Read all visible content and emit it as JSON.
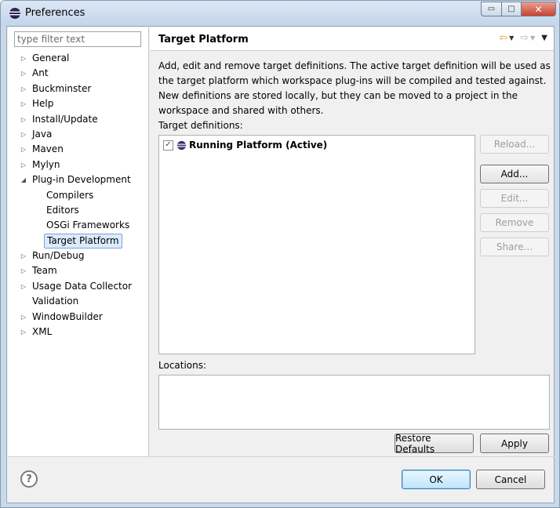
{
  "window": {
    "title": "Preferences",
    "minimize_glyph": "▭",
    "maximize_glyph": "□",
    "close_glyph": "✕"
  },
  "filter": {
    "placeholder": "type filter text",
    "value": ""
  },
  "tree": {
    "items": [
      {
        "label": "General",
        "expandable": true,
        "expanded": false,
        "level": 0
      },
      {
        "label": "Ant",
        "expandable": true,
        "expanded": false,
        "level": 0
      },
      {
        "label": "Buckminster",
        "expandable": true,
        "expanded": false,
        "level": 0
      },
      {
        "label": "Help",
        "expandable": true,
        "expanded": false,
        "level": 0
      },
      {
        "label": "Install/Update",
        "expandable": true,
        "expanded": false,
        "level": 0
      },
      {
        "label": "Java",
        "expandable": true,
        "expanded": false,
        "level": 0
      },
      {
        "label": "Maven",
        "expandable": true,
        "expanded": false,
        "level": 0
      },
      {
        "label": "Mylyn",
        "expandable": true,
        "expanded": false,
        "level": 0
      },
      {
        "label": "Plug-in Development",
        "expandable": true,
        "expanded": true,
        "level": 0
      },
      {
        "label": "Compilers",
        "expandable": false,
        "level": 1
      },
      {
        "label": "Editors",
        "expandable": false,
        "level": 1
      },
      {
        "label": "OSGi Frameworks",
        "expandable": false,
        "level": 1
      },
      {
        "label": "Target Platform",
        "expandable": false,
        "level": 1,
        "selected": true
      },
      {
        "label": "Run/Debug",
        "expandable": true,
        "expanded": false,
        "level": 0
      },
      {
        "label": "Team",
        "expandable": true,
        "expanded": false,
        "level": 0
      },
      {
        "label": "Usage Data Collector",
        "expandable": true,
        "expanded": false,
        "level": 0
      },
      {
        "label": "Validation",
        "expandable": false,
        "level": 0
      },
      {
        "label": "WindowBuilder",
        "expandable": true,
        "expanded": false,
        "level": 0
      },
      {
        "label": "XML",
        "expandable": true,
        "expanded": false,
        "level": 0
      }
    ],
    "collapsed_glyph": "▷",
    "expanded_glyph": "◢"
  },
  "page": {
    "title": "Target Platform",
    "nav": {
      "back_glyph": "⇦",
      "forward_glyph": "⇨",
      "dropdown_glyph": "▼",
      "menu_glyph": "▼"
    },
    "description": "Add, edit and remove target definitions.  The active target definition will be used as the target platform which workspace plug-ins will be compiled and tested against.  New definitions are stored locally, but they can be moved to a project in the workspace and shared with others.",
    "definitions_label": "Target definitions:",
    "definitions": [
      {
        "label": "Running Platform (Active)",
        "checked": true,
        "check_glyph": "✓"
      }
    ],
    "side_buttons": [
      {
        "label": "Reload...",
        "enabled": false
      },
      {
        "label": "Add...",
        "enabled": true
      },
      {
        "label": "Edit...",
        "enabled": false
      },
      {
        "label": "Remove",
        "enabled": false
      },
      {
        "label": "Share...",
        "enabled": false
      }
    ],
    "locations_label": "Locations:",
    "restore_defaults_label": "Restore Defaults",
    "apply_label": "Apply"
  },
  "footer": {
    "help_glyph": "?",
    "ok_label": "OK",
    "cancel_label": "Cancel"
  },
  "colors": {
    "accent": "#3c7fb1",
    "selection_bg": "#dcebfc",
    "selection_border": "#7da2ce",
    "nav_arrow": "#d7a433"
  }
}
